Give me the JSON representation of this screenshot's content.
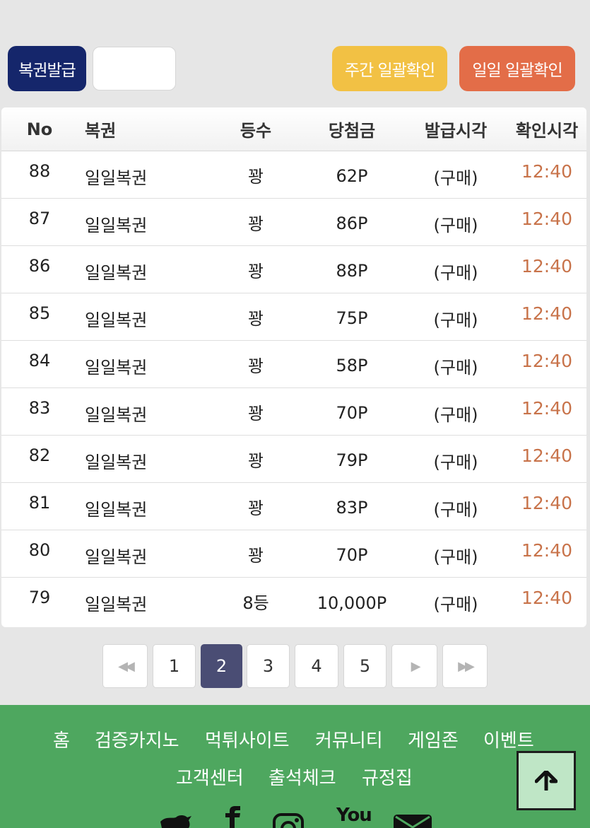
{
  "toolbar": {
    "issue_label": "복권발급",
    "input_value": "",
    "weekly_label": "주간 일괄확인",
    "daily_label": "일일 일괄확인"
  },
  "table": {
    "headers": [
      "No",
      "복권",
      "등수",
      "당첨금",
      "발급시각",
      "확인시각"
    ],
    "rows": [
      {
        "no": "88",
        "name": "일일복권",
        "rank": "꽝",
        "prize": "62P",
        "issued": "(구매)",
        "checked": "12:40"
      },
      {
        "no": "87",
        "name": "일일복권",
        "rank": "꽝",
        "prize": "86P",
        "issued": "(구매)",
        "checked": "12:40"
      },
      {
        "no": "86",
        "name": "일일복권",
        "rank": "꽝",
        "prize": "88P",
        "issued": "(구매)",
        "checked": "12:40"
      },
      {
        "no": "85",
        "name": "일일복권",
        "rank": "꽝",
        "prize": "75P",
        "issued": "(구매)",
        "checked": "12:40"
      },
      {
        "no": "84",
        "name": "일일복권",
        "rank": "꽝",
        "prize": "58P",
        "issued": "(구매)",
        "checked": "12:40"
      },
      {
        "no": "83",
        "name": "일일복권",
        "rank": "꽝",
        "prize": "70P",
        "issued": "(구매)",
        "checked": "12:40"
      },
      {
        "no": "82",
        "name": "일일복권",
        "rank": "꽝",
        "prize": "79P",
        "issued": "(구매)",
        "checked": "12:40"
      },
      {
        "no": "81",
        "name": "일일복권",
        "rank": "꽝",
        "prize": "83P",
        "issued": "(구매)",
        "checked": "12:40"
      },
      {
        "no": "80",
        "name": "일일복권",
        "rank": "꽝",
        "prize": "70P",
        "issued": "(구매)",
        "checked": "12:40"
      },
      {
        "no": "79",
        "name": "일일복권",
        "rank": "8등",
        "prize": "10,000P",
        "issued": "(구매)",
        "checked": "12:40"
      }
    ]
  },
  "pagination": {
    "pages": [
      "1",
      "2",
      "3",
      "4",
      "5"
    ],
    "current": "2"
  },
  "footer": {
    "nav": [
      "홈",
      "검증카지노",
      "먹튀사이트",
      "커뮤니티",
      "게임존",
      "이벤트",
      "고객센터",
      "출석체크",
      "규정집"
    ],
    "social": [
      "twitter-icon",
      "facebook-icon",
      "instagram-icon",
      "youtube-icon",
      "mail-icon"
    ],
    "youtube_text": "You"
  },
  "colors": {
    "issue_button": "#15266b",
    "weekly_button": "#f2c144",
    "daily_button": "#e36d48",
    "check_time": "#c8734a",
    "active_page": "#4a4d74",
    "footer": "#4ea75f"
  }
}
